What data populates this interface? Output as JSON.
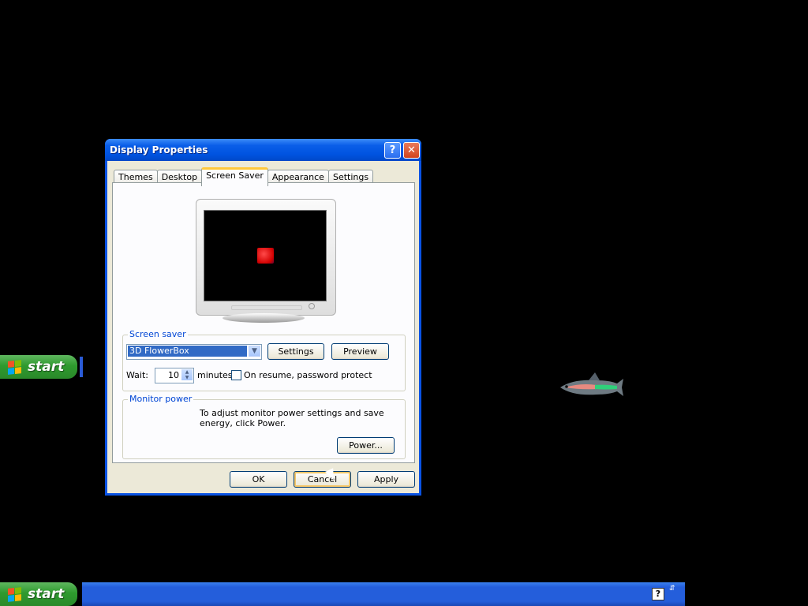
{
  "dialog": {
    "title": "Display Properties",
    "help_btn": "?",
    "close_btn": "✕",
    "tabs": [
      {
        "label": "Themes",
        "active": false
      },
      {
        "label": "Desktop",
        "active": false
      },
      {
        "label": "Screen Saver",
        "active": true
      },
      {
        "label": "Appearance",
        "active": false
      },
      {
        "label": "Settings",
        "active": false
      }
    ],
    "screensaver": {
      "group_label": "Screen saver",
      "selected": "3D FlowerBox",
      "settings_btn": "Settings",
      "preview_btn": "Preview",
      "wait_label": "Wait:",
      "wait_value": "10",
      "minutes_label": "minutes",
      "password_label": "On resume, password protect",
      "password_checked": false
    },
    "monitor_power": {
      "group_label": "Monitor power",
      "description": "To adjust monitor power settings and save energy, click Power.",
      "power_btn": "Power..."
    },
    "buttons": {
      "ok": "OK",
      "cancel": "Cancel",
      "apply": "Apply"
    }
  },
  "taskbar": {
    "start_label": "start",
    "tray_help_icon": "?",
    "tray_arrows": "⇵"
  },
  "colors": {
    "taskbar_blue": "#245edb",
    "start_green": "#2e9a2e",
    "title_blue": "#0053e0",
    "selection_blue": "#316ac5"
  }
}
